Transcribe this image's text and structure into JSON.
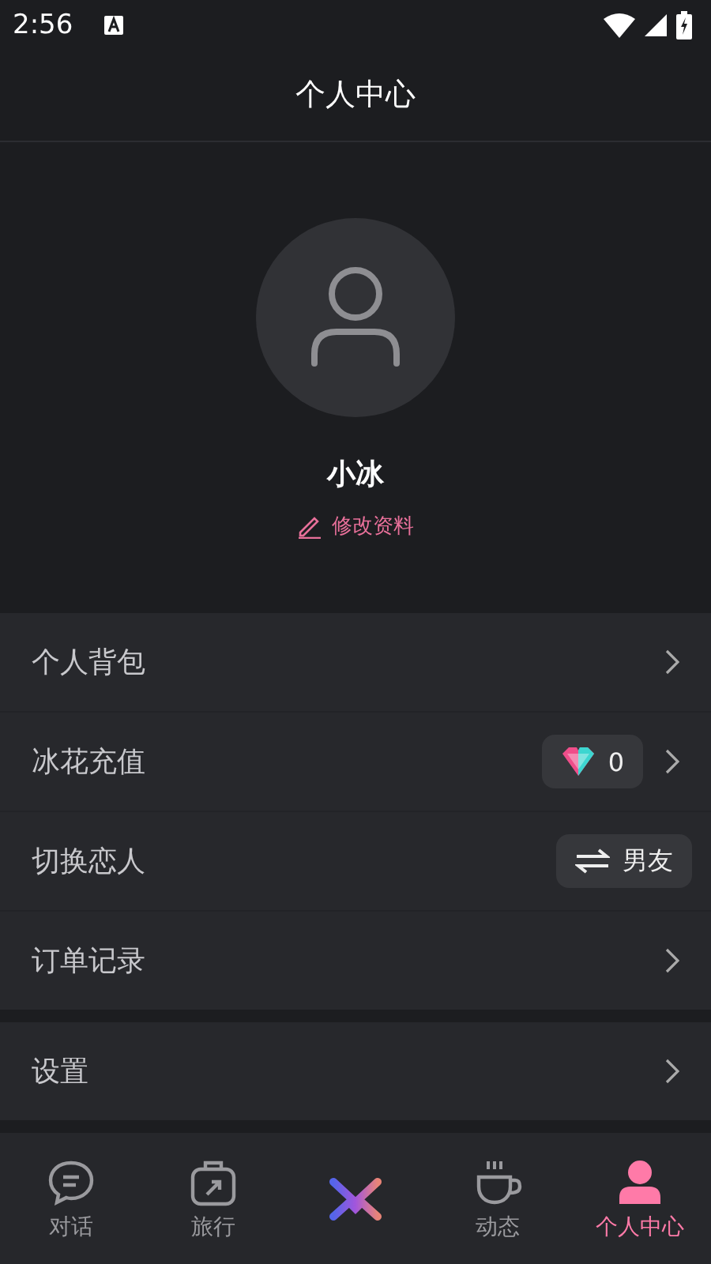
{
  "status_bar": {
    "time": "2:56"
  },
  "header": {
    "title": "个人中心"
  },
  "profile": {
    "name": "小冰",
    "edit_link": "修改资料"
  },
  "menu_groups": [
    {
      "items": [
        {
          "kind": "chevron",
          "label": "个人背包"
        },
        {
          "kind": "balance",
          "label": "冰花充值",
          "value": "0"
        },
        {
          "kind": "switch",
          "label": "切换恋人",
          "value": "男友"
        },
        {
          "kind": "chevron",
          "label": "订单记录"
        }
      ]
    },
    {
      "items": [
        {
          "kind": "chevron",
          "label": "设置"
        }
      ]
    }
  ],
  "bottom_nav": [
    {
      "kind": "chat",
      "label": "对话",
      "selected": false
    },
    {
      "kind": "travel",
      "label": "旅行",
      "selected": false
    },
    {
      "kind": "logo",
      "selected": false
    },
    {
      "kind": "cup",
      "label": "动态",
      "selected": false
    },
    {
      "kind": "person",
      "label": "个人中心",
      "selected": true
    }
  ]
}
